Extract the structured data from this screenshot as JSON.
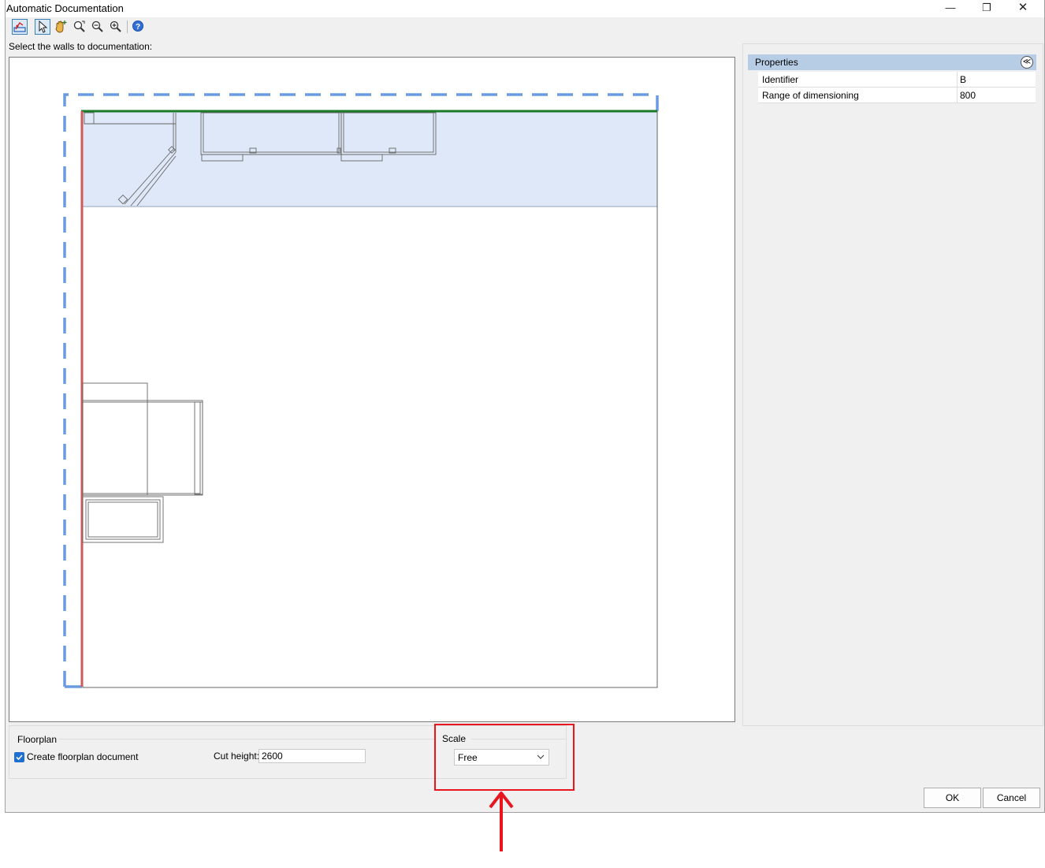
{
  "window": {
    "title": "Automatic Documentation",
    "minimize_glyph": "—",
    "maximize_glyph": "❐",
    "close_glyph": "✕"
  },
  "toolbar": {
    "tools": [
      "select-walls-icon",
      "pointer-icon",
      "pan-hand-icon",
      "zoom-extents-icon",
      "zoom-out-icon",
      "zoom-in-icon",
      "help-icon"
    ]
  },
  "instruction": "Select the walls to documentation:",
  "properties": {
    "header": "Properties",
    "collapse_glyph": "≪",
    "rows": [
      {
        "label": "Identifier",
        "value": "B"
      },
      {
        "label": "Range of dimensioning",
        "value": "800"
      }
    ]
  },
  "floorplan": {
    "title": "Floorplan",
    "create_label": "Create floorplan document",
    "create_checked": true,
    "cut_height_label": "Cut height:",
    "cut_height_value": "2600"
  },
  "scale": {
    "title": "Scale",
    "value": "Free"
  },
  "buttons": {
    "ok": "OK",
    "cancel": "Cancel"
  },
  "colors": {
    "selection_blue": "#6a9be0",
    "selected_wall_green": "#1a7a2a",
    "wall_red": "#d05a5a",
    "room_fill": "#dfe8f8",
    "highlight_red": "#e8141e"
  }
}
